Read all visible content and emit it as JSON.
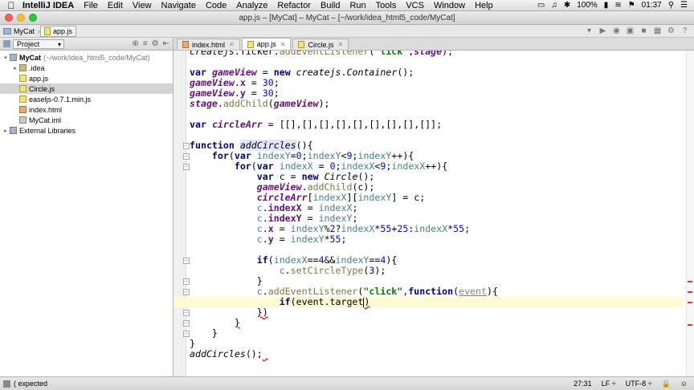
{
  "menubar": {
    "app_name": "IntelliJ IDEA",
    "items": [
      "File",
      "Edit",
      "View",
      "Navigate",
      "Code",
      "Analyze",
      "Refactor",
      "Build",
      "Run",
      "Tools",
      "VCS",
      "Window",
      "Help"
    ],
    "battery": "100%",
    "time": "01:37"
  },
  "window": {
    "title": "app.js – [MyCat] – MyCat – [~/work/idea_html5_code/MyCat]"
  },
  "breadcrumb": {
    "project": "MyCat",
    "file": "app.js"
  },
  "project_panel": {
    "view_mode": "Project",
    "tree": [
      {
        "label": "MyCat",
        "sub": "(~/work/idea_html5_code/MyCat)",
        "icon": "folder-blue",
        "depth": 0,
        "arrow": "▾"
      },
      {
        "label": ".idea",
        "sub": "",
        "icon": "folder",
        "depth": 1,
        "arrow": "▸"
      },
      {
        "label": "app.js",
        "sub": "",
        "icon": "js",
        "depth": 1,
        "arrow": ""
      },
      {
        "label": "Circle.js",
        "sub": "",
        "icon": "js",
        "depth": 1,
        "arrow": "",
        "selected": true
      },
      {
        "label": "easeljs-0.7.1.min.js",
        "sub": "",
        "icon": "js",
        "depth": 1,
        "arrow": ""
      },
      {
        "label": "index.html",
        "sub": "",
        "icon": "html",
        "depth": 1,
        "arrow": ""
      },
      {
        "label": "MyCat.iml",
        "sub": "",
        "icon": "iml",
        "depth": 1,
        "arrow": ""
      },
      {
        "label": "External Libraries",
        "sub": "",
        "icon": "lib",
        "depth": 0,
        "arrow": "▸"
      }
    ]
  },
  "tabs": [
    {
      "label": "index.html",
      "icon": "html",
      "active": false
    },
    {
      "label": "app.js",
      "icon": "js",
      "active": true
    },
    {
      "label": "Circle.js",
      "icon": "js",
      "active": false
    }
  ],
  "editor": {
    "lines": [
      "<span class=\"fn\">createjs</span>.Ticker.<span class=\"m\">addEventListener</span>(<span class=\"str\">\"tick\"</span>,<span class=\"gv\">stage</span>);",
      "",
      "<span class=\"kw\">var</span> <span class=\"gv\">gameView</span> = <span class=\"kw\">new</span> <span class=\"fn\">createjs</span>.<span class=\"fn\">Container</span>();",
      "<span class=\"gv\">gameView</span>.<span class=\"prop\">x</span> = <span class=\"num\">30</span>;",
      "<span class=\"gv\">gameView</span>.<span class=\"prop\">y</span> = <span class=\"num\">30</span>;",
      "<span class=\"gv\">stage</span>.<span class=\"m\">addChild</span>(<span class=\"gv\">gameView</span>);",
      "",
      "<span class=\"kw\">var</span> <span class=\"gv\">circleArr</span> = [[],[],[],[],[],[],[],[],[]];",
      "",
      "<span class=\"kw\">function</span> <span class=\"fnd\">addCircles</span>(){",
      "    <span class=\"kw\">for</span>(<span class=\"kw\">var</span> <span class=\"v\">indexY</span>=<span class=\"num\">0</span>;<span class=\"v\">indexY</span>&lt;<span class=\"num\">9</span>;<span class=\"v\">indexY</span>++){",
      "        <span class=\"kw\">for</span>(<span class=\"kw\">var</span> <span class=\"v\">indexX</span> = <span class=\"num\">0</span>;<span class=\"v\">indexX</span>&lt;<span class=\"num\">9</span>;<span class=\"v\">indexX</span>++){",
      "            <span class=\"kw\">var</span> c = <span class=\"kw\">new</span> <span class=\"fn\">Circle</span>();",
      "            <span class=\"gv\">gameView</span>.<span class=\"m\">addChild</span>(c);",
      "            <span class=\"gv\">circleArr</span>[<span class=\"v\">indexX</span>][<span class=\"v\">indexY</span>] = c;",
      "            <span class=\"v\">c</span>.<span class=\"prop\">indexX</span> = <span class=\"v\">indexX</span>;",
      "            <span class=\"v\">c</span>.<span class=\"prop\">indexY</span> = <span class=\"v\">indexY</span>;",
      "            <span class=\"v\">c</span>.<span class=\"prop\">x</span> = <span class=\"v\">indexY</span>%<span class=\"num\">2</span>?<span class=\"v\">indexX</span>*<span class=\"num\">55</span>+<span class=\"num\">25</span>:<span class=\"v\">indexX</span>*<span class=\"num\">55</span>;",
      "            <span class=\"v\">c</span>.<span class=\"prop\">y</span> = <span class=\"v\">indexY</span>*<span class=\"num\">55</span>;",
      "",
      "            <span class=\"kw\">if</span>(<span class=\"v\">indexX</span>==<span class=\"num\">4</span>&amp;&amp;<span class=\"v\">indexY</span>==<span class=\"num\">4</span>){",
      "                <span class=\"v\">c</span>.<span class=\"m\">setCircleType</span>(<span class=\"num\">3</span>);",
      "            }",
      "            <span class=\"v\">c</span>.<span class=\"m\">addEventListener</span>(<span class=\"str\">\"click\"</span>,<span class=\"kw\">function</span>(<span class=\"par\">event</span>){",
      "                <span class=\"kw\">if</span>(event.target<span class=\"caret\"></span><span class=\"err\">)</span>",
      "            <span class=\"err\">})</span>",
      "        <span class=\"err\">}</span>",
      "    }",
      "}",
      "<span class=\"fn\">addCircles</span>();<span class=\"err\"> </span>"
    ],
    "current_line": 24
  },
  "statusbar": {
    "message": "( expected",
    "position": "27:31",
    "line_separator": "LF ÷",
    "encoding": "UTF-8 ÷"
  },
  "colors": {
    "keyword": "#000080",
    "global_var": "#660e7a",
    "number": "#0000ff",
    "string": "#008000",
    "error_mark": "#dd3333"
  }
}
